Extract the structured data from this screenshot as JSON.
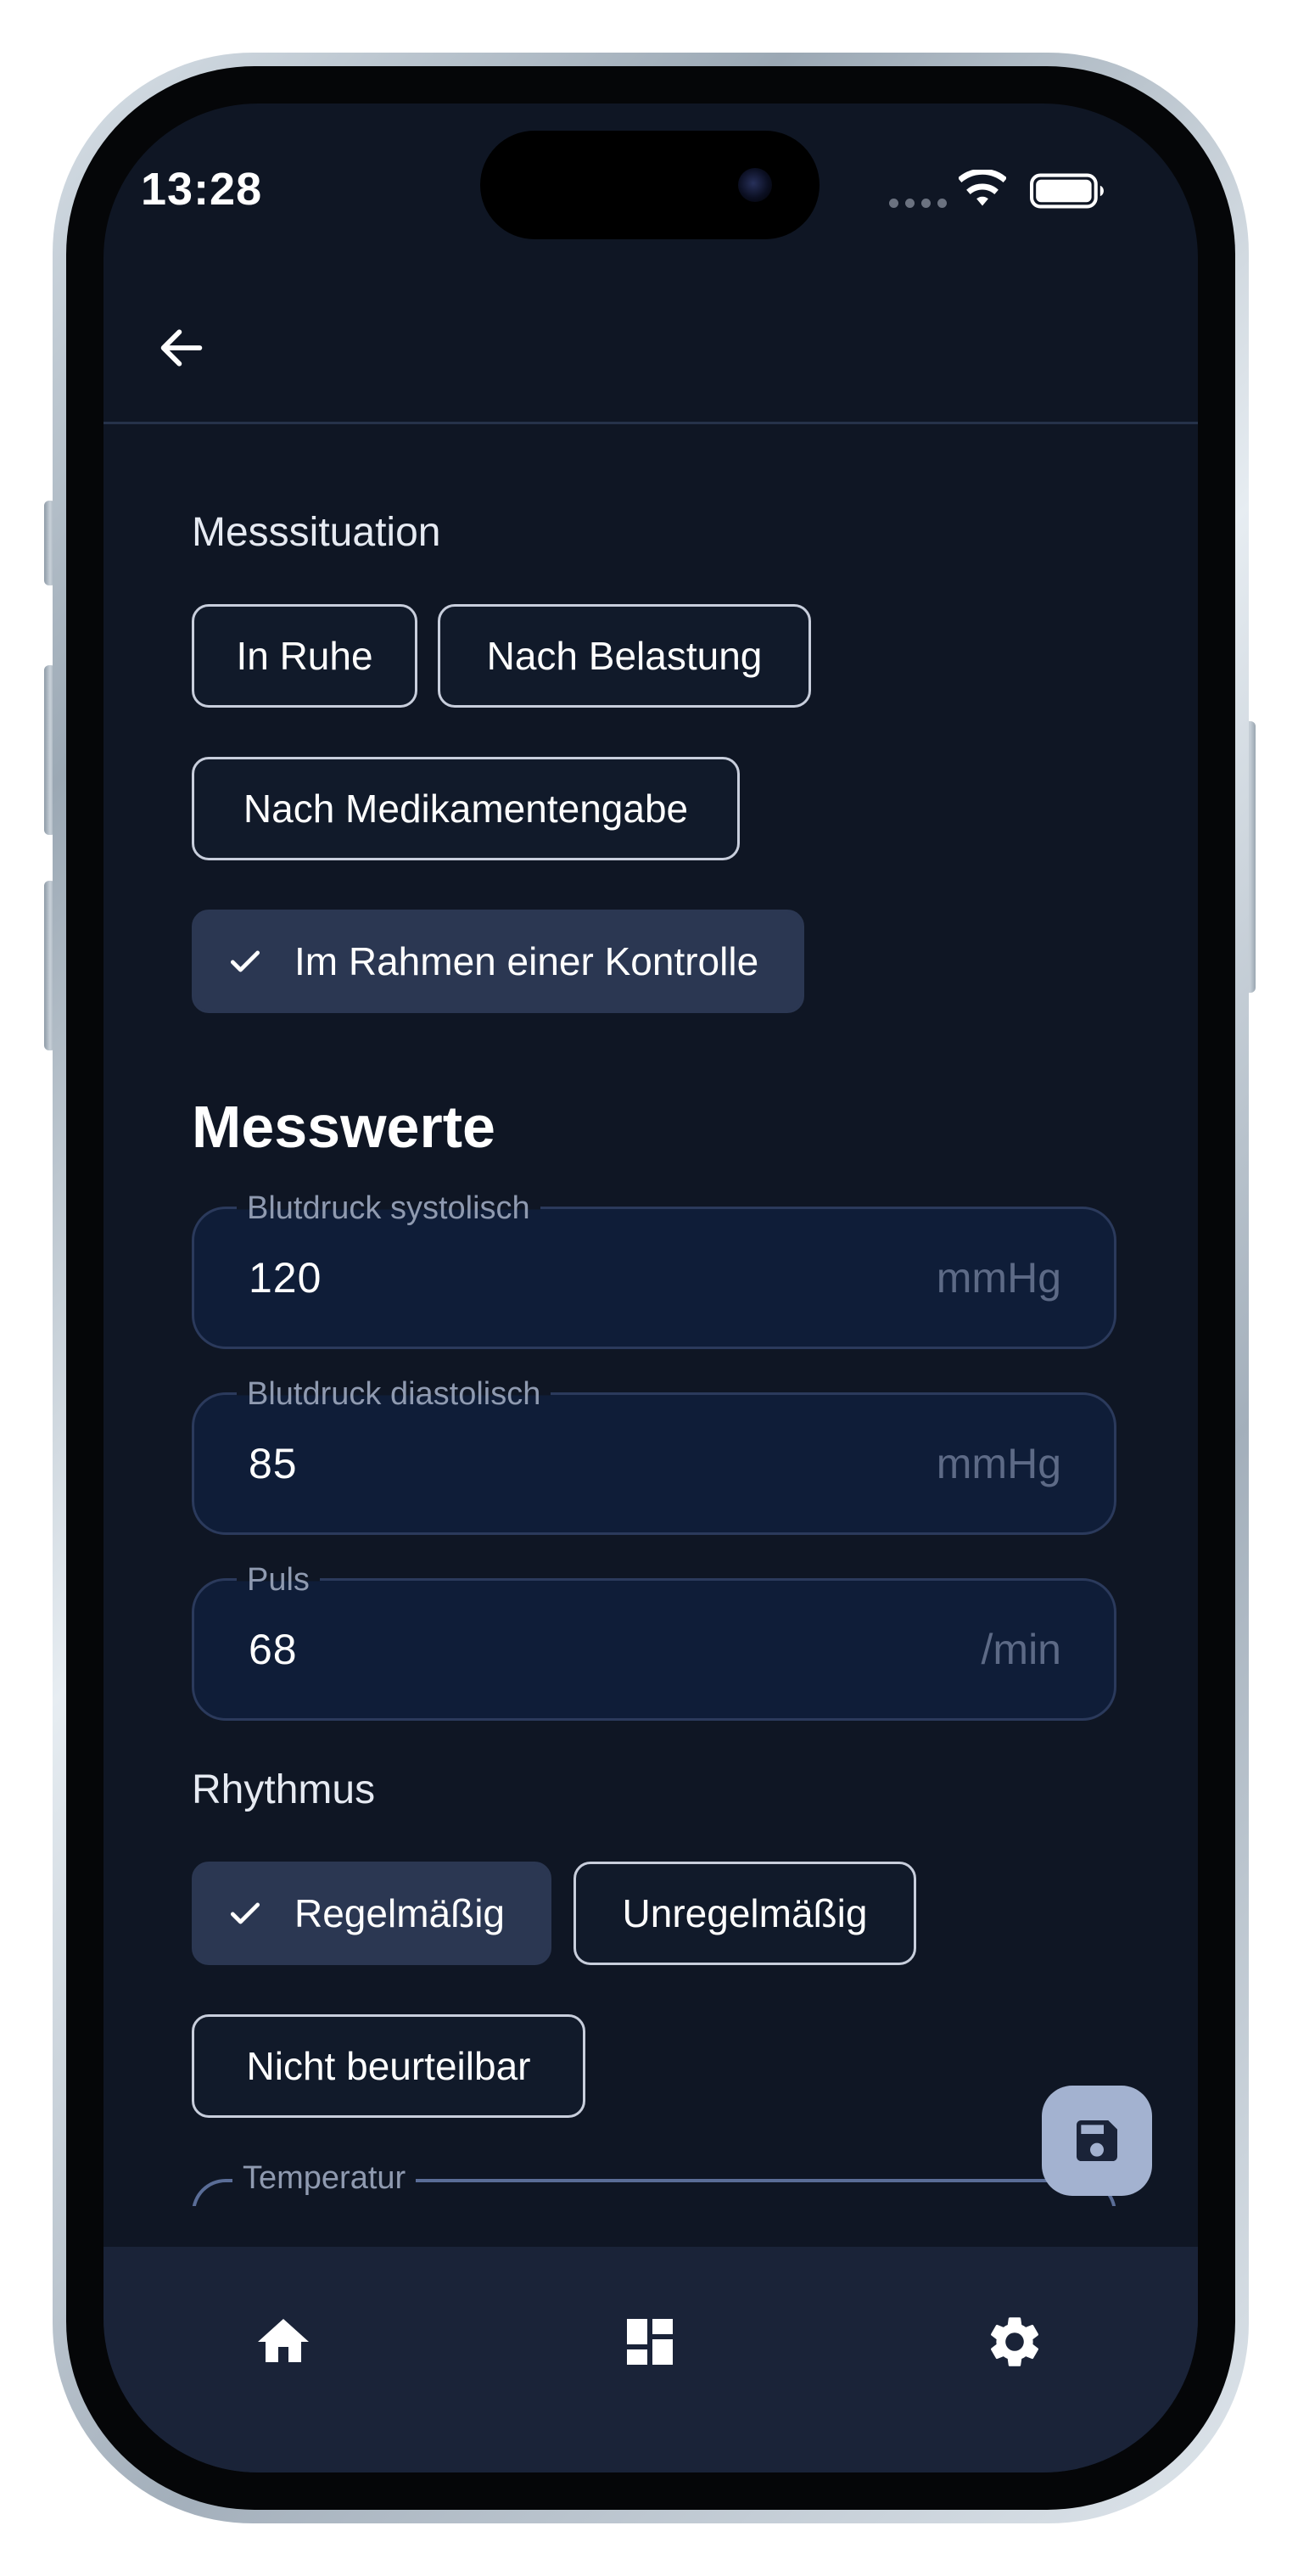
{
  "status_bar": {
    "time": "13:28"
  },
  "header": {
    "back_icon": "arrow-left-icon"
  },
  "situation": {
    "label": "Messsituation",
    "options": [
      {
        "label": "In Ruhe",
        "selected": false
      },
      {
        "label": "Nach Belastung",
        "selected": false
      },
      {
        "label": "Nach Medikamentengabe",
        "selected": false
      },
      {
        "label": "Im Rahmen einer Kontrolle",
        "selected": true
      }
    ]
  },
  "measurements": {
    "heading": "Messwerte",
    "fields": [
      {
        "label": "Blutdruck systolisch",
        "value": "120",
        "unit": "mmHg"
      },
      {
        "label": "Blutdruck diastolisch",
        "value": "85",
        "unit": "mmHg"
      },
      {
        "label": "Puls",
        "value": "68",
        "unit": "/min"
      }
    ]
  },
  "rhythm": {
    "label": "Rhythmus",
    "options": [
      {
        "label": "Regelmäßig",
        "selected": true
      },
      {
        "label": "Unregelmäßig",
        "selected": false
      },
      {
        "label": "Nicht beurteilbar",
        "selected": false
      }
    ]
  },
  "temperature": {
    "label": "Temperatur"
  },
  "fab": {
    "icon": "save-icon"
  },
  "bottom_nav": {
    "items": [
      {
        "icon": "home-icon"
      },
      {
        "icon": "dashboard-icon"
      },
      {
        "icon": "settings-icon"
      }
    ]
  },
  "colors": {
    "background": "#0f1624",
    "selected_chip": "#2b3752",
    "field_background": "#0f1d38",
    "fab": "#a3b2d0",
    "nav_background": "#1a2338"
  }
}
